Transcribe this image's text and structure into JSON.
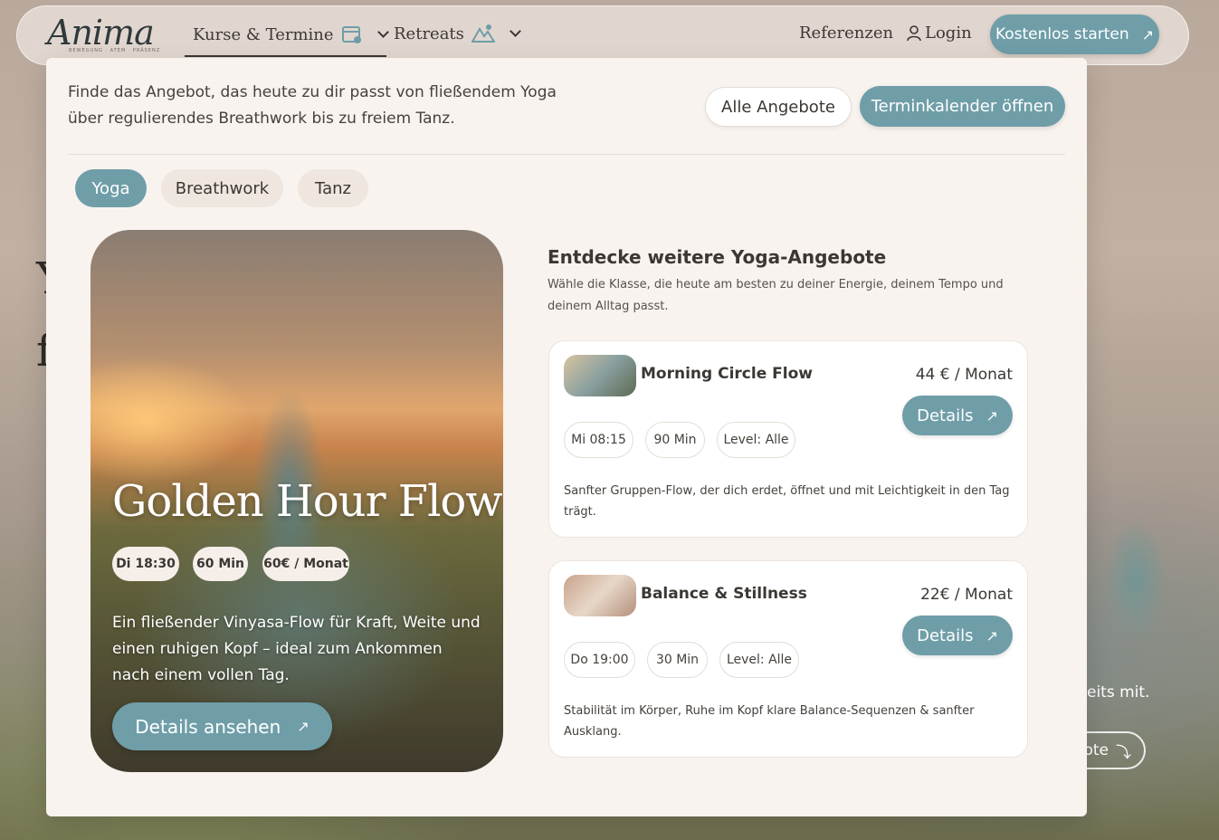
{
  "header": {
    "logo": "Anima",
    "logo_tagline": "BEWEGUNG · ATEM · PRÄSENZ",
    "nav": [
      {
        "label": "Kurse & Termine",
        "icon": "calendar-icon"
      },
      {
        "label": "Retreats",
        "icon": "mountain-icon"
      }
    ],
    "references": "Referenzen",
    "login": "Login",
    "cta": "Kostenlos starten"
  },
  "panel": {
    "intro": "Finde das Angebot, das heute zu dir passt von fließendem Yoga über regulierendes Breathwork bis zu freiem Tanz.",
    "all_offers": "Alle Angebote",
    "calendar": "Terminkalender öffnen",
    "tabs": [
      "Yoga",
      "Breathwork",
      "Tanz"
    ]
  },
  "feature": {
    "title": "Golden Hour Flow",
    "pills": [
      "Di 18:30",
      "60 Min",
      "60€ / Monat"
    ],
    "desc": "Ein fließender Vinyasa-Flow für Kraft, Weite und einen ruhigen Kopf – ideal zum Ankommen nach einem vollen Tag.",
    "button": "Details ansehen"
  },
  "more": {
    "title": "Entdecke weitere Yoga-Angebote",
    "subtitle": "Wähle die Klasse, die heute am besten zu deiner Energie, deinem Tempo und deinem Alltag passt.",
    "offers": [
      {
        "name": "Morning Circle Flow",
        "price": "44 € / Monat",
        "button": "Details",
        "pills": [
          "Mi 08:15",
          "90 Min",
          "Level: Alle"
        ],
        "desc": "Sanfter Gruppen-Flow, der dich erdet, öffnet und mit Leichtigkeit in den Tag trägt."
      },
      {
        "name": "Balance & Stillness",
        "price": "22€ / Monat",
        "button": "Details",
        "pills": [
          "Do 19:00",
          "30 Min",
          "Level: Alle"
        ],
        "desc": "Stabilität im Körper, Ruhe im Kopf klare Balance-Sequenzen & sanfter Ausklang."
      }
    ]
  },
  "background": {
    "text_fragment": "eits mit.",
    "cta_fragment": "ote"
  }
}
